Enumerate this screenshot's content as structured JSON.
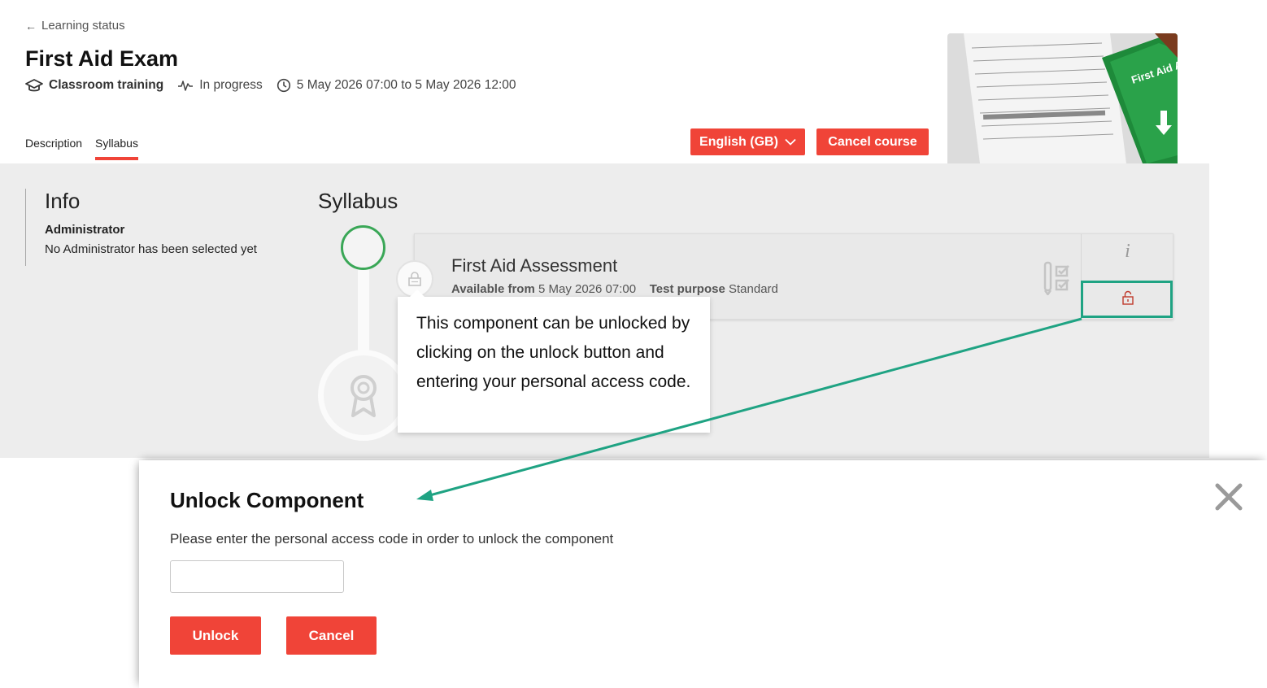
{
  "header": {
    "back_label": "Learning status",
    "title": "First Aid Exam",
    "course_type": "Classroom training",
    "status": "In progress",
    "schedule": "5 May 2026 07:00 to 5 May 2026 12:00"
  },
  "tabs": [
    {
      "label": "Description",
      "active": false
    },
    {
      "label": "Syllabus",
      "active": true
    }
  ],
  "actions": {
    "language_label": "English (GB)",
    "cancel_course_label": "Cancel course"
  },
  "course_image": {
    "icon": "first-aid-assessment-photo",
    "text": "First Aid Assessment"
  },
  "info": {
    "title": "Info",
    "administrator_label": "Administrator",
    "administrator_value": "No Administrator has been selected yet"
  },
  "syllabus": {
    "title": "Syllabus",
    "component": {
      "title": "First Aid Assessment",
      "available_label": "Available from",
      "available_value": "5 May 2026 07:00",
      "purpose_label": "Test purpose",
      "purpose_value": "Standard",
      "info_icon": "i"
    }
  },
  "tooltip": {
    "text": "This component can be unlocked by clicking on the unlock button and entering your personal access code."
  },
  "modal": {
    "title": "Unlock Component",
    "description": "Please enter the personal access code in order to unlock the component",
    "input_value": "",
    "unlock_label": "Unlock",
    "cancel_label": "Cancel"
  },
  "colors": {
    "accent": "#f04438",
    "annotation": "#1fa383",
    "timeline_done": "#3aa757",
    "content_bg": "#ededed"
  }
}
